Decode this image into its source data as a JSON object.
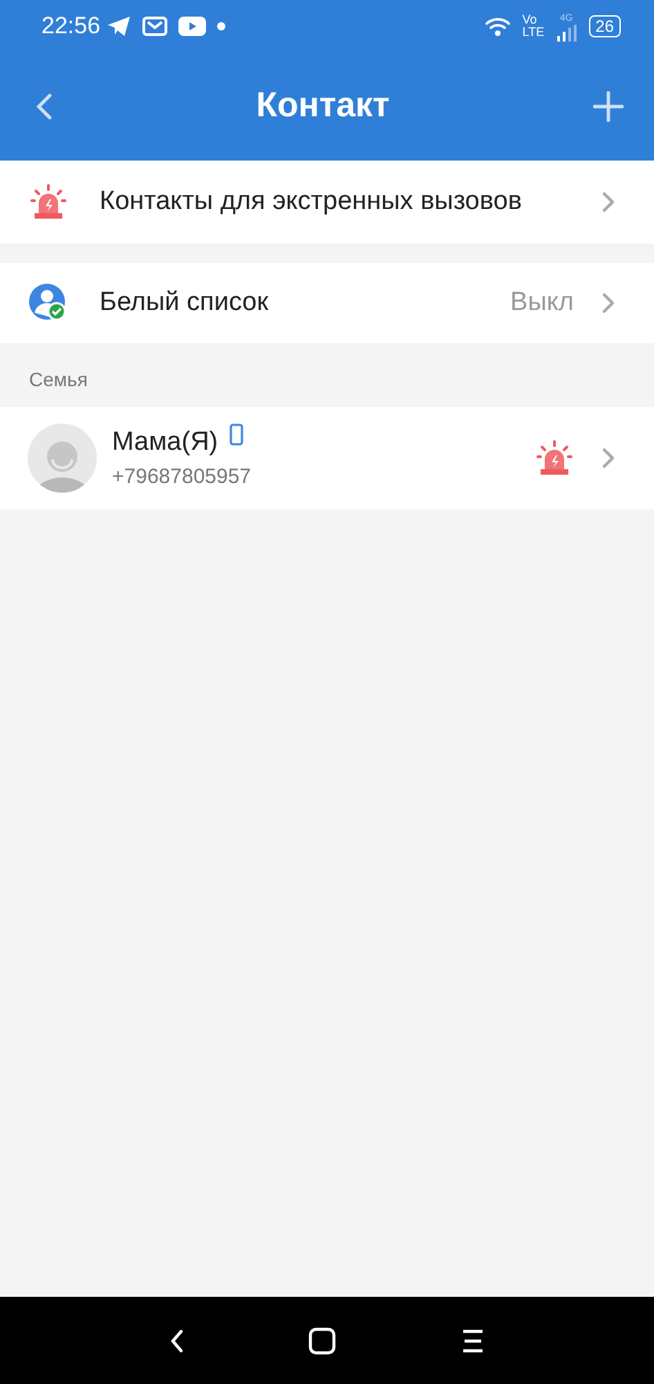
{
  "status_bar": {
    "time": "22:56",
    "volte_top": "Vo",
    "volte_bottom": "LTE",
    "network": "4G",
    "battery": "26"
  },
  "header": {
    "title": "Контакт"
  },
  "menu_items": [
    {
      "kind": "emergency",
      "label": "Контакты для экстренных вызовов"
    },
    {
      "kind": "whitelist",
      "label": "Белый список",
      "value": "Выкл"
    }
  ],
  "section": {
    "title": "Семья"
  },
  "contacts": [
    {
      "name": "Мама(Я)",
      "phone": "+79687805957",
      "has_device": true,
      "emergency": true
    }
  ]
}
